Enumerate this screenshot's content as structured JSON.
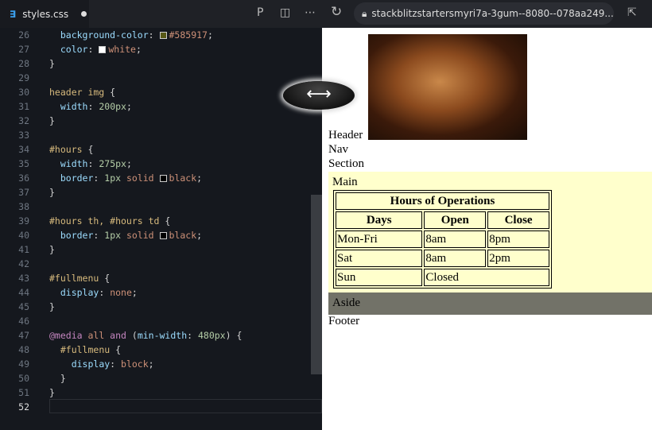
{
  "tab": {
    "filename": "styles.css",
    "icon": "css-file-icon"
  },
  "toolbar": {
    "url": "stackblitzstartersmyri7a-3gum--8080--078aa249...."
  },
  "editor": {
    "lines": [
      {
        "n": "26",
        "tokens": [
          [
            "  ",
            "pun"
          ],
          [
            "background-color",
            "prop"
          ],
          [
            ": ",
            "pun"
          ],
          [
            "#585917",
            "val",
            "#585917"
          ],
          [
            ";",
            "pun"
          ]
        ]
      },
      {
        "n": "27",
        "tokens": [
          [
            "  ",
            "pun"
          ],
          [
            "color",
            "prop"
          ],
          [
            ": ",
            "pun"
          ],
          [
            "white",
            "val",
            "#ffffff"
          ],
          [
            ";",
            "pun"
          ]
        ]
      },
      {
        "n": "28",
        "tokens": [
          [
            "}",
            "pun"
          ]
        ]
      },
      {
        "n": "29",
        "tokens": []
      },
      {
        "n": "30",
        "tokens": [
          [
            "header img",
            "sel"
          ],
          [
            " {",
            "pun"
          ]
        ]
      },
      {
        "n": "31",
        "tokens": [
          [
            "  ",
            "pun"
          ],
          [
            "width",
            "prop"
          ],
          [
            ": ",
            "pun"
          ],
          [
            "200px",
            "num"
          ],
          [
            ";",
            "pun"
          ]
        ]
      },
      {
        "n": "32",
        "tokens": [
          [
            "}",
            "pun"
          ]
        ]
      },
      {
        "n": "33",
        "tokens": []
      },
      {
        "n": "34",
        "tokens": [
          [
            "#hours",
            "sel"
          ],
          [
            " {",
            "pun"
          ]
        ]
      },
      {
        "n": "35",
        "tokens": [
          [
            "  ",
            "pun"
          ],
          [
            "width",
            "prop"
          ],
          [
            ": ",
            "pun"
          ],
          [
            "275px",
            "num"
          ],
          [
            ";",
            "pun"
          ]
        ]
      },
      {
        "n": "36",
        "tokens": [
          [
            "  ",
            "pun"
          ],
          [
            "border",
            "prop"
          ],
          [
            ": ",
            "pun"
          ],
          [
            "1px",
            "num"
          ],
          [
            " solid ",
            "val"
          ],
          [
            "black",
            "val",
            "#000000"
          ],
          [
            ";",
            "pun"
          ]
        ]
      },
      {
        "n": "37",
        "tokens": [
          [
            "}",
            "pun"
          ]
        ]
      },
      {
        "n": "38",
        "tokens": []
      },
      {
        "n": "39",
        "tokens": [
          [
            "#hours th, #hours td",
            "sel"
          ],
          [
            " {",
            "pun"
          ]
        ]
      },
      {
        "n": "40",
        "tokens": [
          [
            "  ",
            "pun"
          ],
          [
            "border",
            "prop"
          ],
          [
            ": ",
            "pun"
          ],
          [
            "1px",
            "num"
          ],
          [
            " solid ",
            "val"
          ],
          [
            "black",
            "val",
            "#000000"
          ],
          [
            ";",
            "pun"
          ]
        ]
      },
      {
        "n": "41",
        "tokens": [
          [
            "}",
            "pun"
          ]
        ]
      },
      {
        "n": "42",
        "tokens": []
      },
      {
        "n": "43",
        "tokens": [
          [
            "#fullmenu",
            "sel"
          ],
          [
            " {",
            "pun"
          ]
        ]
      },
      {
        "n": "44",
        "tokens": [
          [
            "  ",
            "pun"
          ],
          [
            "display",
            "prop"
          ],
          [
            ": ",
            "pun"
          ],
          [
            "none",
            "val"
          ],
          [
            ";",
            "pun"
          ]
        ]
      },
      {
        "n": "45",
        "tokens": [
          [
            "}",
            "pun"
          ]
        ]
      },
      {
        "n": "46",
        "tokens": []
      },
      {
        "n": "47",
        "tokens": [
          [
            "@media",
            "at"
          ],
          [
            " all ",
            "val"
          ],
          [
            "and",
            "at"
          ],
          [
            " (",
            "pun"
          ],
          [
            "min-width",
            "prop"
          ],
          [
            ": ",
            "pun"
          ],
          [
            "480px",
            "num"
          ],
          [
            ") {",
            "pun"
          ]
        ]
      },
      {
        "n": "48",
        "tokens": [
          [
            "  ",
            "pun"
          ],
          [
            "#fullmenu",
            "sel"
          ],
          [
            " {",
            "pun"
          ]
        ]
      },
      {
        "n": "49",
        "tokens": [
          [
            "    ",
            "pun"
          ],
          [
            "display",
            "prop"
          ],
          [
            ": ",
            "pun"
          ],
          [
            "block",
            "val"
          ],
          [
            ";",
            "pun"
          ]
        ]
      },
      {
        "n": "50",
        "tokens": [
          [
            "  }",
            "pun"
          ]
        ]
      },
      {
        "n": "51",
        "tokens": [
          [
            "}",
            "pun"
          ]
        ]
      },
      {
        "n": "52",
        "tokens": []
      }
    ]
  },
  "preview": {
    "header": "Header",
    "nav": "Nav",
    "section": "Section",
    "main": "Main",
    "aside": "Aside",
    "footer": "Footer",
    "table": {
      "caption": "Hours of Operations",
      "headers": [
        "Days",
        "Open",
        "Close"
      ],
      "rows": [
        [
          "Mon-Fri",
          "8am",
          "8pm"
        ],
        [
          "Sat",
          "8am",
          "2pm"
        ],
        [
          "Sun",
          "Closed"
        ]
      ]
    }
  }
}
